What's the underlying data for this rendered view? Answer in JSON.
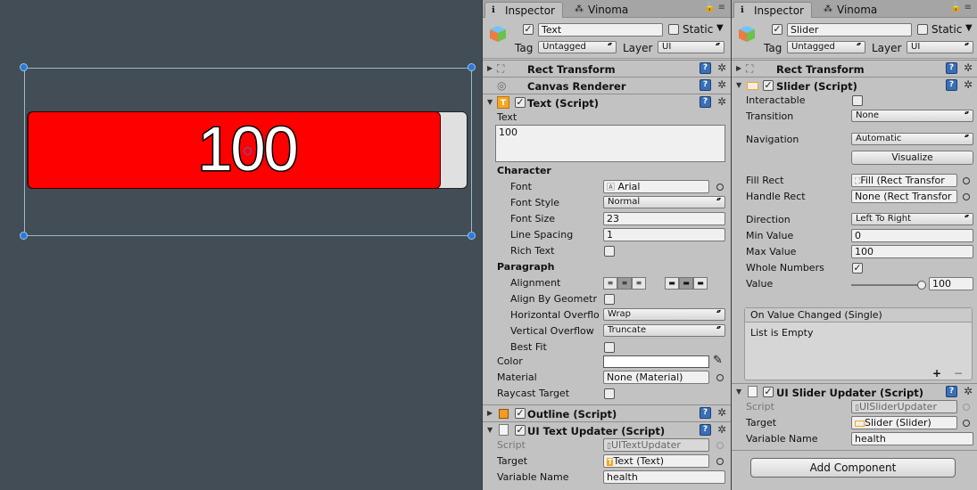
{
  "scene": {
    "label": "100"
  },
  "inspector1": {
    "tabs": [
      {
        "label": "Inspector"
      },
      {
        "label": "Vinoma"
      }
    ],
    "object_name": "Text",
    "static_label": "Static",
    "tag_label": "Tag",
    "tag_value": "Untagged",
    "layer_label": "Layer",
    "layer_value": "UI",
    "components": {
      "rect": "Rect Transform",
      "canvas": "Canvas Renderer",
      "text": "Text (Script)",
      "outline": "Outline (Script)",
      "updater": "UI Text Updater (Script)"
    },
    "text_label": "Text",
    "text_value": "100",
    "character_label": "Character",
    "font_label": "Font",
    "font_value": "Arial",
    "font_style_label": "Font Style",
    "font_style_value": "Normal",
    "font_size_label": "Font Size",
    "font_size_value": "23",
    "line_spacing_label": "Line Spacing",
    "line_spacing_value": "1",
    "rich_text_label": "Rich Text",
    "paragraph_label": "Paragraph",
    "alignment_label": "Alignment",
    "align_geometry_label": "Align By Geometr",
    "h_overflow_label": "Horizontal Overflo",
    "h_overflow_value": "Wrap",
    "v_overflow_label": "Vertical Overflow",
    "v_overflow_value": "Truncate",
    "best_fit_label": "Best Fit",
    "color_label": "Color",
    "material_label": "Material",
    "material_value": "None (Material)",
    "raycast_label": "Raycast Target",
    "script_label": "Script",
    "script_value": "UITextUpdater",
    "target_label": "Target",
    "target_value": "Text (Text)",
    "varname_label": "Variable Name",
    "varname_value": "health"
  },
  "inspector2": {
    "tabs": [
      {
        "label": "Inspector"
      },
      {
        "label": "Vinoma"
      }
    ],
    "object_name": "Slider",
    "static_label": "Static",
    "tag_label": "Tag",
    "tag_value": "Untagged",
    "layer_label": "Layer",
    "layer_value": "UI",
    "components": {
      "rect": "Rect Transform",
      "slider": "Slider (Script)",
      "updater": "UI Slider Updater (Script)"
    },
    "interactable_label": "Interactable",
    "transition_label": "Transition",
    "transition_value": "None",
    "navigation_label": "Navigation",
    "navigation_value": "Automatic",
    "visualize_label": "Visualize",
    "fill_rect_label": "Fill Rect",
    "fill_rect_value": "Fill (Rect Transfor",
    "handle_rect_label": "Handle Rect",
    "handle_rect_value": "None (Rect Transfor",
    "direction_label": "Direction",
    "direction_value": "Left To Right",
    "min_label": "Min Value",
    "min_value": "0",
    "max_label": "Max Value",
    "max_value": "100",
    "whole_label": "Whole Numbers",
    "value_label": "Value",
    "value_value": "100",
    "value_fraction": 1.0,
    "event_title": "On Value Changed (Single)",
    "event_empty": "List is Empty",
    "plus": "+",
    "minus": "−",
    "script_label": "Script",
    "script_value": "UISliderUpdater",
    "target_label": "Target",
    "target_value": "Slider (Slider)",
    "varname_label": "Variable Name",
    "varname_value": "health",
    "add_component": "Add Component"
  },
  "colors": {
    "fill": "#ff0000",
    "background": "#e0e0e0",
    "scene_bg": "#424d55",
    "inspector_bg": "#c2c2c2"
  }
}
